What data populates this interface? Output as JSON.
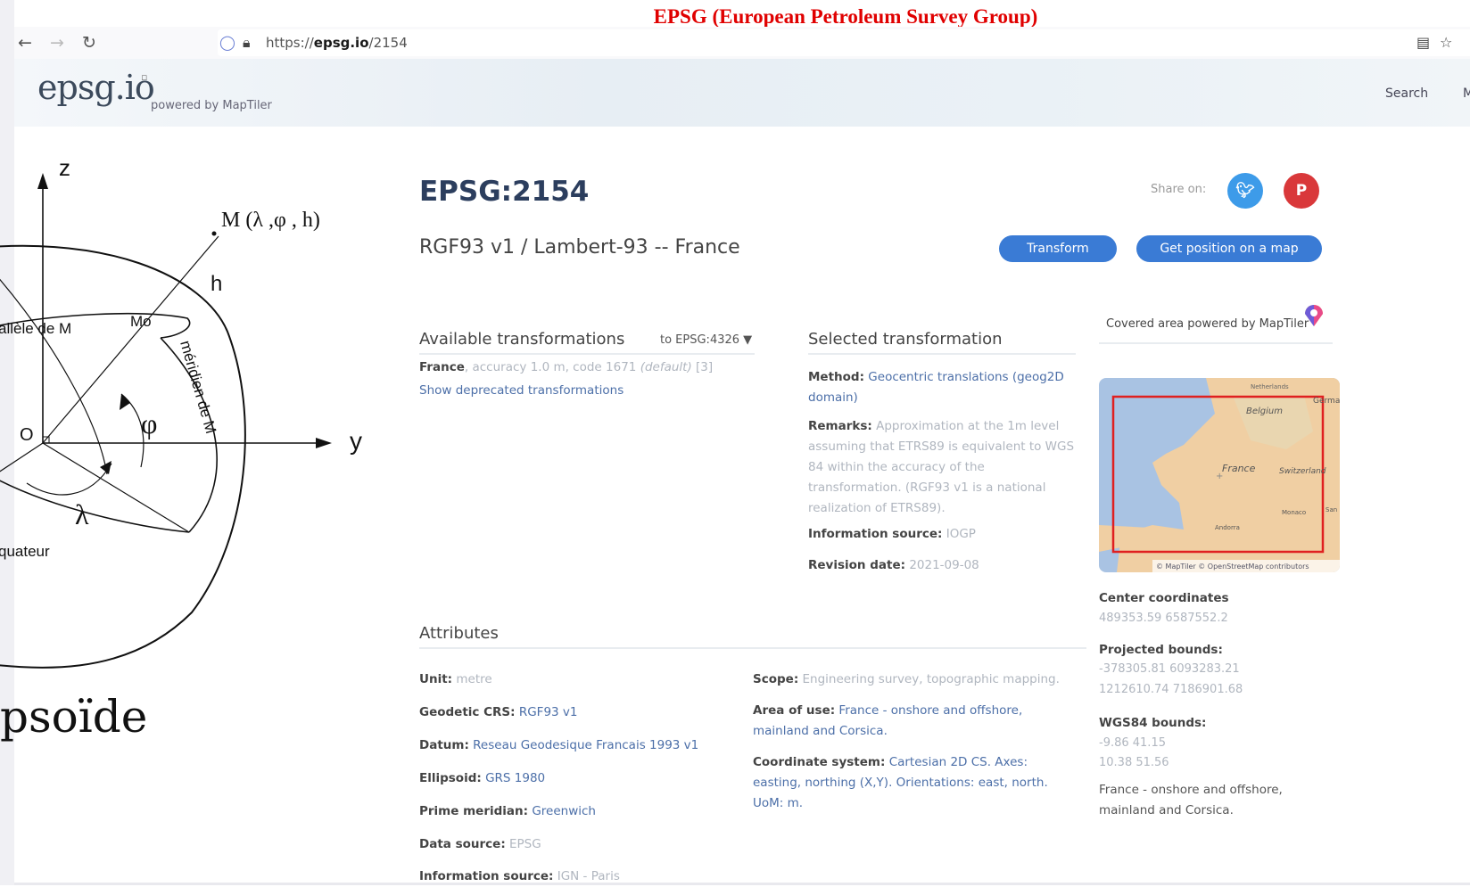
{
  "banner": "EPSG (European Petroleum Survey Group)",
  "browser": {
    "url_prefix": "https://",
    "url_host": "epsg.io",
    "url_path": "/2154"
  },
  "header": {
    "logo": "epsg.io",
    "powered_by": "powered by MapTiler",
    "nav": [
      "Search",
      "M"
    ]
  },
  "diagram": {
    "axis_z": "z",
    "axis_y": "y",
    "point_label": "M (λ ,φ , h)",
    "h": "h",
    "mo": "Mo",
    "parallel": "allèle de M",
    "meridian": "méridien de M",
    "origin": "O",
    "phi": "φ",
    "lambda": "λ",
    "equator": "quateur",
    "title": "psoïde"
  },
  "main": {
    "code": "EPSG:2154",
    "name": "RGF93 v1 / Lambert-93 -- France",
    "share_label": "Share on:",
    "transform_button": "Transform",
    "position_button": "Get position on a map",
    "available": {
      "title": "Available transformations",
      "target": "to EPSG:4326 ▼",
      "item_name": "France",
      "item_detail": ", accuracy 1.0 m, code 1671 ",
      "item_default": "(default)",
      "item_ref": "[3]",
      "deprecated": "Show deprecated transformations"
    },
    "selected": {
      "title": "Selected transformation",
      "method_label": "Method:",
      "method_value": "Geocentric translations (geog2D domain)",
      "remarks_label": "Remarks:",
      "remarks_value": "Approximation at the 1m level assuming that ETRS89 is equivalent to WGS 84 within the accuracy of the transformation. (RGF93 v1 is a national realization of ETRS89).",
      "source_label": "Information source:",
      "source_value": "IOGP",
      "revision_label": "Revision date:",
      "revision_value": "2021-09-08"
    },
    "coverage": {
      "title": "Covered area powered by MapTiler",
      "map_attribution": "© MapTiler © OpenStreetMap contributors",
      "map_labels": [
        "Netherlands",
        "Belgium",
        "Germa",
        "France",
        "Switzerland",
        "Monaco",
        "Andorra",
        "San"
      ],
      "center_label": "Center coordinates",
      "center_value": "489353.59 6587552.2",
      "projected_label": "Projected bounds:",
      "projected_1": "-378305.81 6093283.21",
      "projected_2": "1212610.74 7186901.68",
      "wgs_label": "WGS84 bounds:",
      "wgs_1": "-9.86 41.15",
      "wgs_2": "10.38 51.56",
      "area_text": "France - onshore and offshore, mainland and Corsica."
    },
    "attributes": {
      "title": "Attributes",
      "unit_label": "Unit:",
      "unit_value": "metre",
      "geodetic_label": "Geodetic CRS:",
      "geodetic_value": "RGF93 v1",
      "datum_label": "Datum:",
      "datum_value": "Reseau Geodesique Francais 1993 v1",
      "ellipsoid_label": "Ellipsoid:",
      "ellipsoid_value": "GRS 1980",
      "meridian_label": "Prime meridian:",
      "meridian_value": "Greenwich",
      "datasource_label": "Data source:",
      "datasource_value": "EPSG",
      "infosource_label": "Information source:",
      "infosource_value": "IGN - Paris",
      "scope_label": "Scope:",
      "scope_value": "Engineering survey, topographic mapping.",
      "area_label": "Area of use:",
      "area_value": "France - onshore and offshore, mainland and Corsica.",
      "cs_label": "Coordinate system:",
      "cs_value": "Cartesian 2D CS. Axes: easting, northing (X,Y). Orientations: east, north. UoM: m."
    }
  },
  "colors": {
    "accent": "#3a7bd5",
    "title": "#2c3e5e",
    "twitter": "#3d9be9",
    "pinterest": "#d9383a",
    "banner": "#e00000"
  }
}
